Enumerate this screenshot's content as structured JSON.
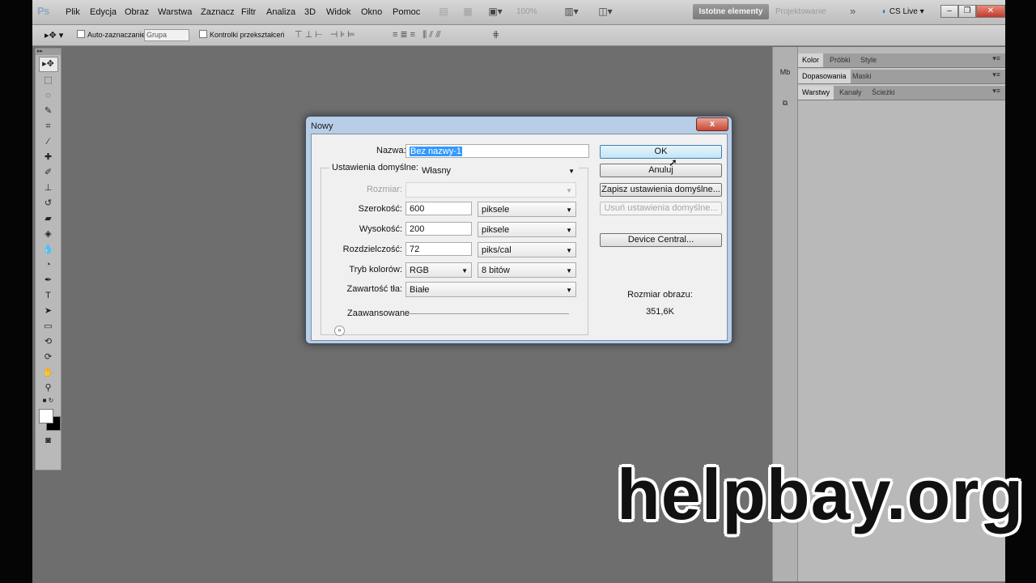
{
  "app": {
    "logo": "Ps"
  },
  "menu": [
    "Plik",
    "Edycja",
    "Obraz",
    "Warstwa",
    "Zaznacz",
    "Filtr",
    "Analiza",
    "3D",
    "Widok",
    "Okno",
    "Pomoc"
  ],
  "menubar": {
    "zoom": "100%",
    "workspace_active": "Istotne elementy",
    "workspace_other": "Projektowanie",
    "more": "»",
    "cs_live": "CS Live",
    "minimize": "–",
    "restore": "❐",
    "close": "✕"
  },
  "options": {
    "auto_select_label": "Auto-zaznaczanie:",
    "auto_select_value": "Grupa",
    "transform_controls_label": "Kontrolki przekształceń"
  },
  "panels": {
    "row1": [
      "Kolor",
      "Próbki",
      "Style"
    ],
    "row2": [
      "Dopasowania",
      "Maski"
    ],
    "row3": [
      "Warstwy",
      "Kanały",
      "Ścieżki"
    ]
  },
  "dialog": {
    "title": "Nowy",
    "close": "x",
    "name_label": "Nazwa:",
    "name_value": "Bez nazwy-1",
    "preset_label": "Ustawienia domyślne:",
    "preset_value": "Własny",
    "size_label": "Rozmiar:",
    "width_label": "Szerokość:",
    "width_value": "600",
    "width_unit": "piksele",
    "height_label": "Wysokość:",
    "height_value": "200",
    "height_unit": "piksele",
    "resolution_label": "Rozdzielczość:",
    "resolution_value": "72",
    "resolution_unit": "piks/cal",
    "color_mode_label": "Tryb kolorów:",
    "color_mode_value": "RGB",
    "bit_depth_value": "8 bitów",
    "background_label": "Zawartość tła:",
    "background_value": "Białe",
    "advanced_label": "Zaawansowane",
    "ok": "OK",
    "cancel": "Anuluj",
    "save_preset": "Zapisz ustawienia domyślne...",
    "delete_preset": "Usuń ustawienia domyślne...",
    "device_central": "Device Central...",
    "image_size_label": "Rozmiar obrazu:",
    "image_size_value": "351,6K"
  },
  "watermark": "helpbay.org"
}
